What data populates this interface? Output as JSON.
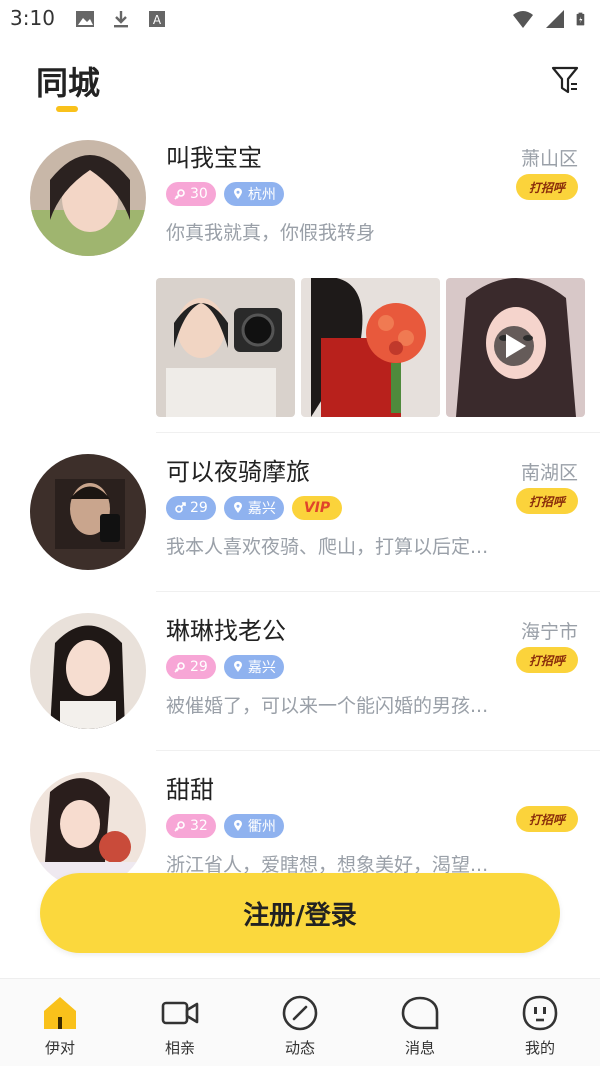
{
  "status_bar": {
    "time": "3:10"
  },
  "header": {
    "title": "同城"
  },
  "users": [
    {
      "name": "叫我宝宝",
      "age": "30",
      "gender": "female",
      "city": "杭州",
      "district": "萧山区",
      "bio": "你真我就真，你假我转身",
      "greet": "打招呼"
    },
    {
      "name": "可以夜骑摩旅",
      "age": "29",
      "gender": "male",
      "city": "嘉兴",
      "vip": "VIP",
      "district": "南湖区",
      "bio": "我本人喜欢夜骑、爬山，打算以后定...",
      "greet": "打招呼"
    },
    {
      "name": "琳琳找老公",
      "age": "29",
      "gender": "female",
      "city": "嘉兴",
      "district": "海宁市",
      "bio": "被催婚了，可以来一个能闪婚的男孩...",
      "greet": "打招呼"
    },
    {
      "name": "甜甜",
      "age": "32",
      "gender": "female",
      "city": "衢州",
      "district": "",
      "bio": "浙江省人，爱瞎想，想象美好，渴望...",
      "greet": "打招呼"
    }
  ],
  "cta": {
    "label": "注册/登录"
  },
  "nav": [
    {
      "label": "伊对",
      "icon": "home-icon",
      "active": true
    },
    {
      "label": "相亲",
      "icon": "video-icon"
    },
    {
      "label": "动态",
      "icon": "compass-icon"
    },
    {
      "label": "消息",
      "icon": "message-icon"
    },
    {
      "label": "我的",
      "icon": "profile-icon"
    }
  ],
  "colors": {
    "accent": "#fbd83d",
    "female_tag": "#f7a6d6",
    "city_tag": "#8fb2ef",
    "muted_text": "#9aa0a8"
  }
}
